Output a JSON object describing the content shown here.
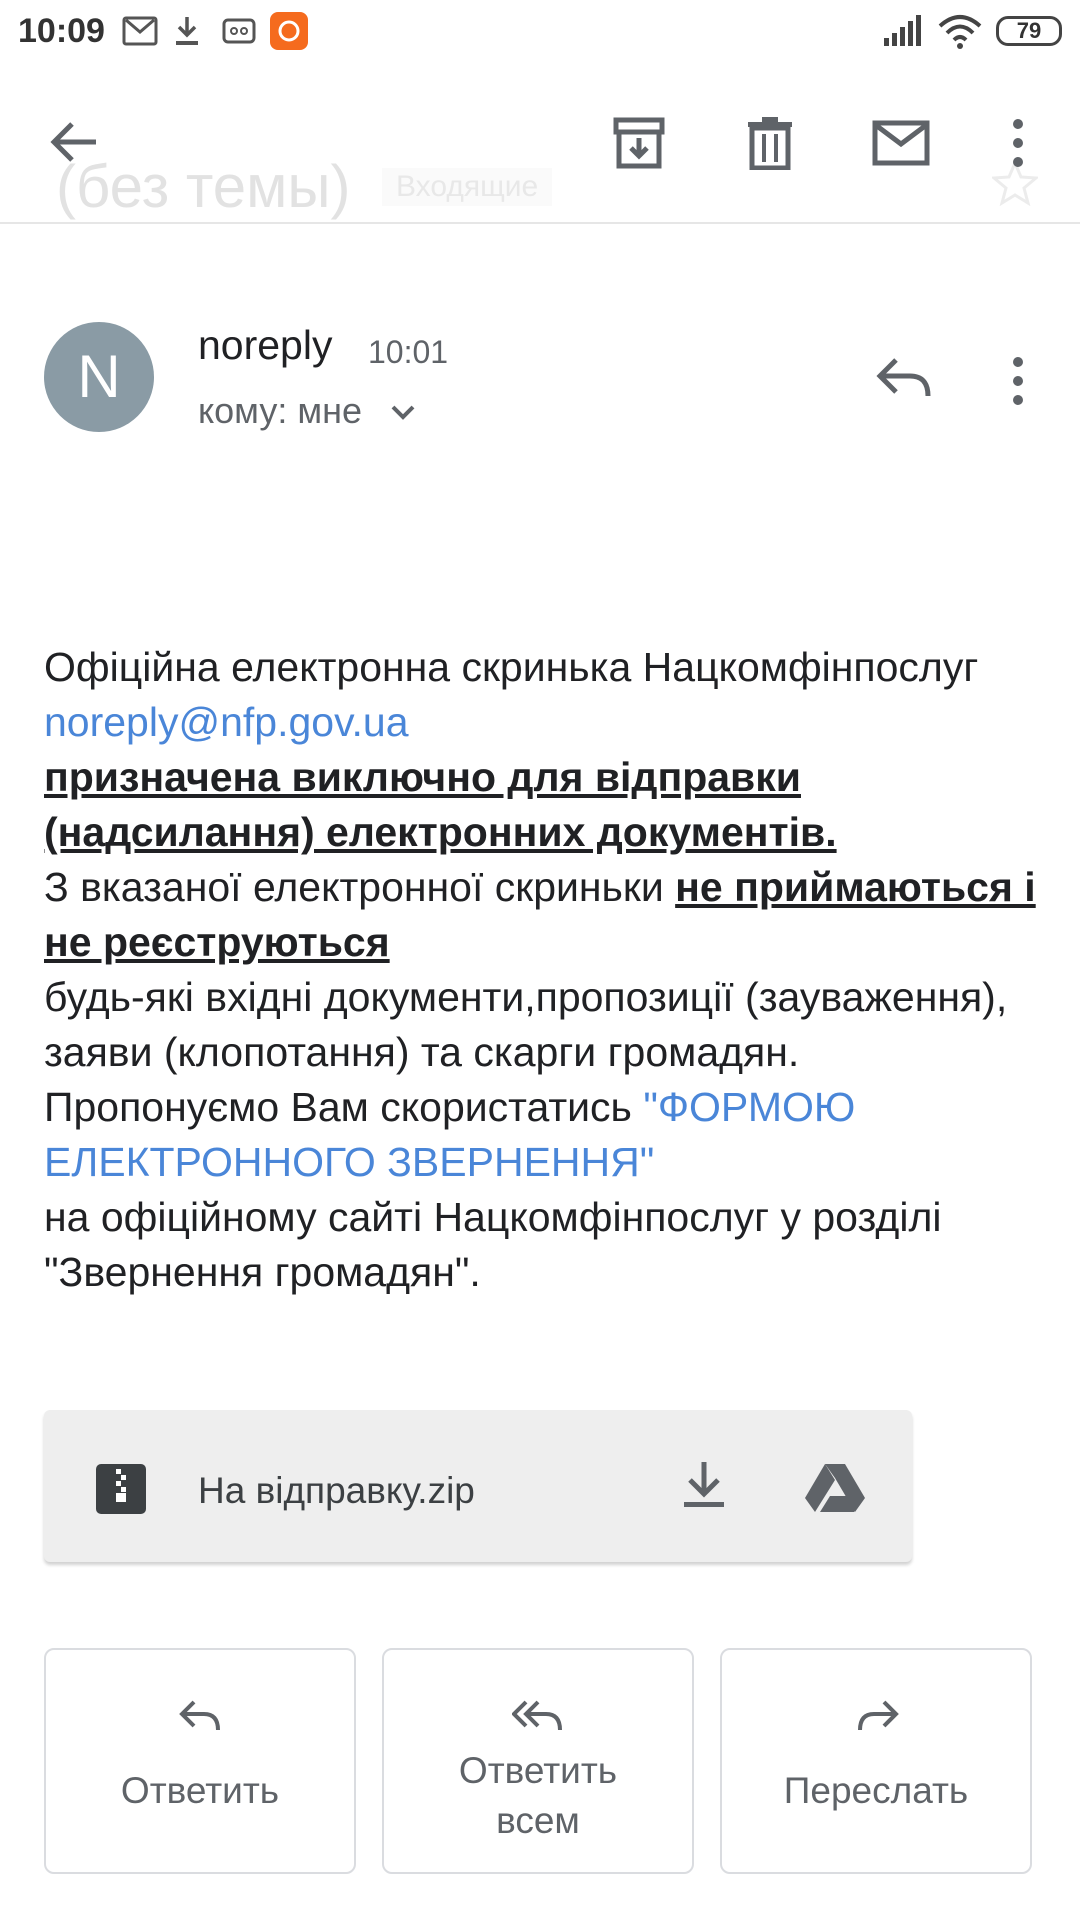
{
  "status_bar": {
    "time": "10:09",
    "battery": "79"
  },
  "header": {
    "subject": "(без темы)",
    "label": "Входящие"
  },
  "message": {
    "avatar_letter": "N",
    "sender": "noreply",
    "time": "10:01",
    "recipient": "кому: мне"
  },
  "body": {
    "p1": "Офіційна електронна скринька Нацкомфінпослуг ",
    "email_link": "noreply@nfp.gov.ua",
    "bold1": "призначена виключно для відправки (надсилання) електронних документів.",
    "p2": "З вказаної електронної скриньки ",
    "bold2": "не приймаються і не реєструються",
    "p3": "будь-які вхідні документи,пропозиції (зауваження), заяви (клопотання) та скарги громадян.",
    "p4": "Пропонуємо Вам скористатись ",
    "form_link": "\"ФОРМОЮ ЕЛЕКТРОННОГО ЗВЕРНЕННЯ\"",
    "p5": "на офіційному сайті Нацкомфінпослуг у розділі \"Звернення громадян\"."
  },
  "attachment": {
    "filename": "На відправку.zip"
  },
  "actions": {
    "reply": "Ответить",
    "reply_all": "Ответить всем",
    "forward": "Переслать"
  },
  "icons": [
    "gmail-icon",
    "download-icon",
    "voicemail-icon",
    "mi-app-icon",
    "signal-icon",
    "wifi-icon",
    "battery-icon",
    "back-arrow-icon",
    "archive-icon",
    "delete-icon",
    "mark-unread-icon",
    "more-vert-icon",
    "star-icon",
    "reply-icon",
    "chevron-down-icon",
    "zip-file-icon",
    "drive-icon",
    "reply-all-icon",
    "forward-icon"
  ],
  "colors": {
    "link": "#4a86d8",
    "avatar": "#8a9ba5",
    "mi_orange": "#f56b1e"
  }
}
